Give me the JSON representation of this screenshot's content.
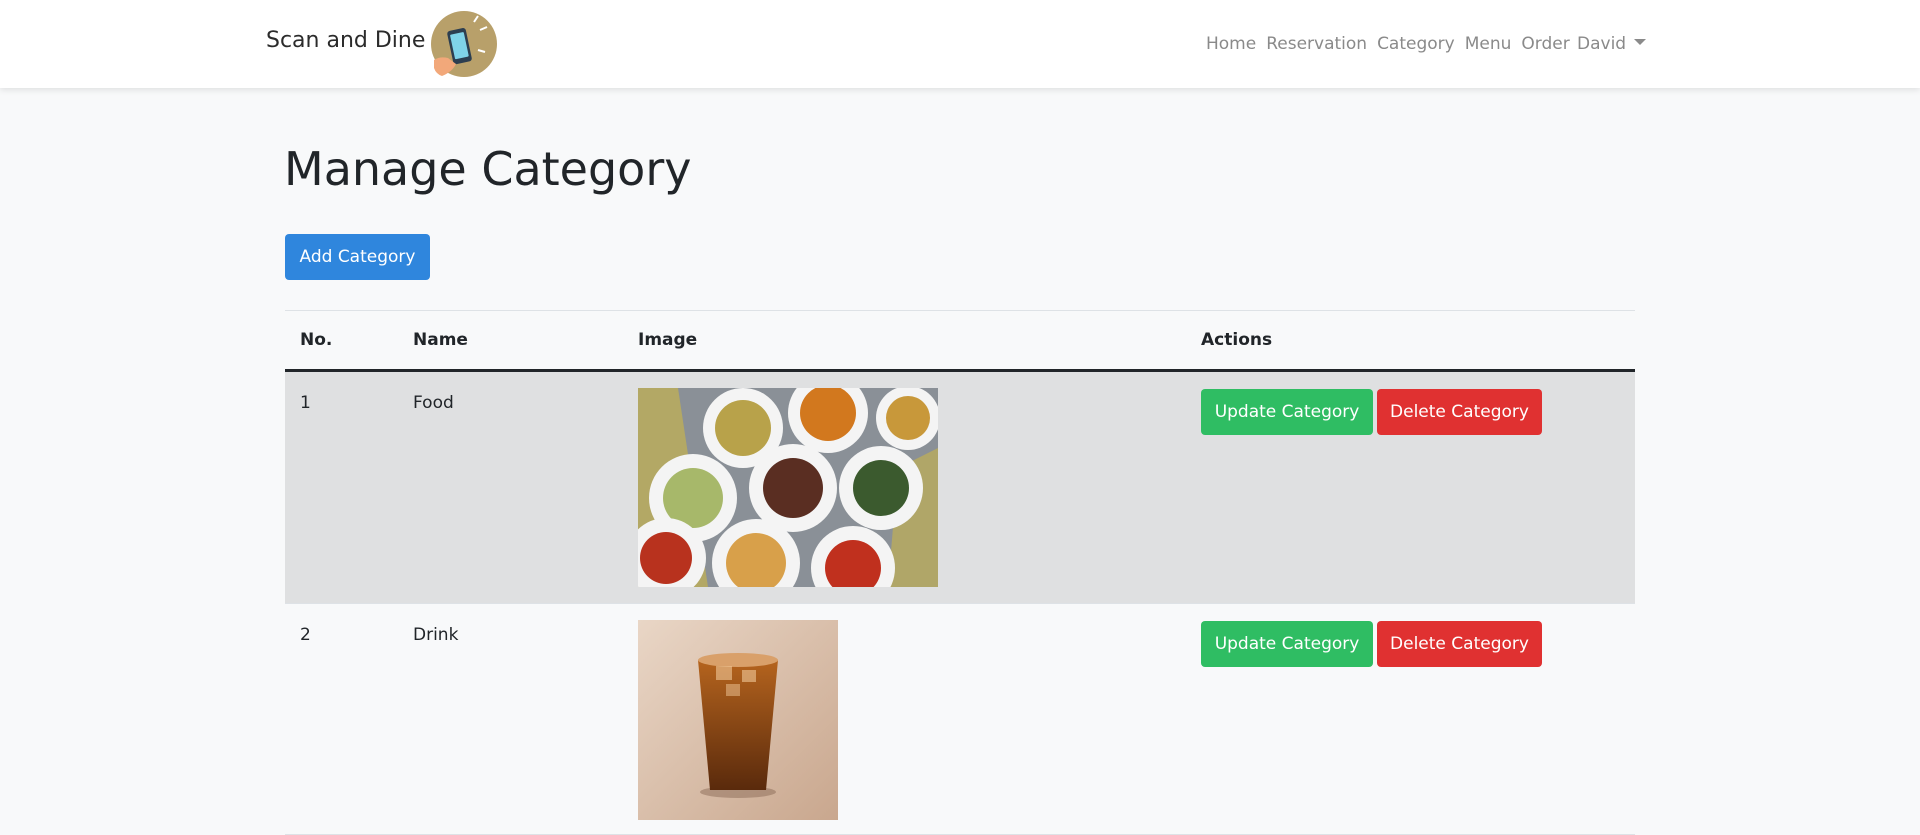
{
  "navbar": {
    "brand": "Scan and Dine",
    "logo_icon": "phone-scan-logo-icon",
    "links": [
      "Home",
      "Reservation",
      "Category",
      "Menu",
      "Order"
    ],
    "user": "David"
  },
  "page": {
    "title": "Manage Category",
    "add_button": "Add Category"
  },
  "table": {
    "headers": [
      "No.",
      "Name",
      "Image",
      "Actions"
    ],
    "rows": [
      {
        "no": "1",
        "name": "Food",
        "image_icon": "food-dishes-photo",
        "update": "Update Category",
        "delete": "Delete Category"
      },
      {
        "no": "2",
        "name": "Drink",
        "image_icon": "iced-tea-photo",
        "update": "Update Category",
        "delete": "Delete Category"
      }
    ]
  },
  "colors": {
    "primary": "#2f86dd",
    "success": "#2fbd63",
    "danger": "#e03131",
    "row_highlight": "#dfe0e1",
    "background": "#f8f9fa"
  }
}
